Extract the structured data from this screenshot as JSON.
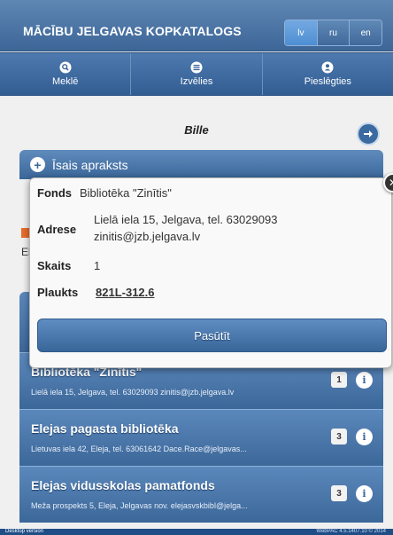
{
  "header": {
    "title": "MĀCĪBU JELGAVAS KOPKATALOGS",
    "languages": [
      {
        "label": "lv",
        "active": true
      },
      {
        "label": "ru",
        "active": false
      },
      {
        "label": "en",
        "active": false
      }
    ]
  },
  "nav": {
    "items": [
      {
        "label": "Meklē",
        "icon": "search-icon"
      },
      {
        "label": "Izvēlies",
        "icon": "list-icon"
      },
      {
        "label": "Pieslēgties",
        "icon": "user-icon"
      }
    ]
  },
  "item": {
    "title": "Bille",
    "next_icon": "arrow-right-icon"
  },
  "section": {
    "label": "Īsais apraksts",
    "side_letter": "El"
  },
  "popup": {
    "rows": [
      {
        "label": "Fonds",
        "value": "Bibliotēka \"Zinītis\""
      },
      {
        "label": "Adrese",
        "value_line1": "Lielā iela 15, Jelgava, tel. 63029093",
        "value_line2": "zinitis@jzb.jelgava.lv"
      },
      {
        "label": "Skaits",
        "value": "1"
      },
      {
        "label": "Plaukts",
        "value": "821L-312.6"
      }
    ],
    "order_button": "Pasūtīt",
    "close_icon": "close-icon"
  },
  "libraries": [
    {
      "name": "Bibliotēka \"Zinītis\"",
      "address": "Lielā iela 15, Jelgava, tel. 63029093 zinitis@jzb.jelgava.lv",
      "count": "1"
    },
    {
      "name": "Elejas pagasta bibliotēka",
      "address": "Lietuvas iela 42, Eleja, tel. 63061642 Dace.Race@jelgavas...",
      "count": "3"
    },
    {
      "name": "Elejas vidusskolas pamatfonds",
      "address": "Meža prospekts 5, Eleja, Jelgavas nov. elejasvskbibl@jelga...",
      "count": "3"
    }
  ],
  "footer": {
    "left": "Desktop version",
    "right": "WebPAC 4.5.1407.10 © 2014"
  }
}
